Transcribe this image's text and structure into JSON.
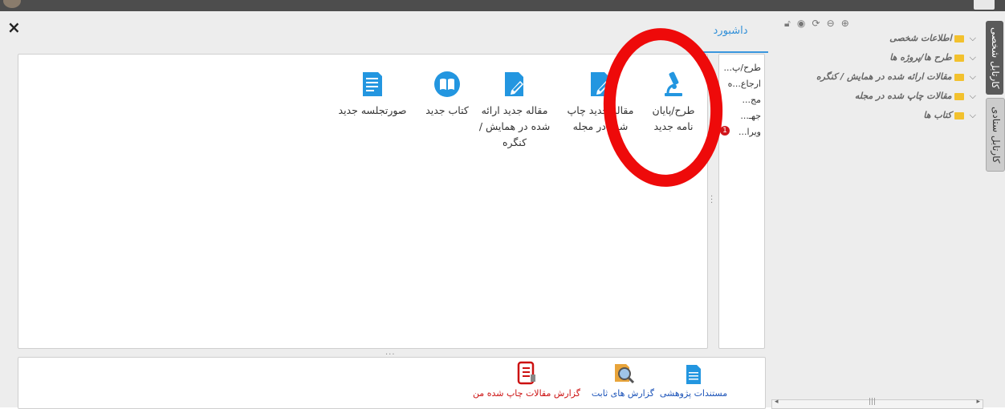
{
  "main": {
    "close_label": "×",
    "tab_label": "داشبورد",
    "sidebar_items": [
      "طرح/پ...",
      "ارجاع...ه",
      "مج...",
      "جهـ...",
      "ویرا..."
    ],
    "sidebar_badge": "1",
    "tiles": [
      {
        "label": "طرح/پایان نامه جدید",
        "icon": "microscope-icon"
      },
      {
        "label": "مقاله جدید چاپ شده در مجله",
        "icon": "document-edit-icon"
      },
      {
        "label": "مقاله جدید ارائه شده در همایش / کنگره",
        "icon": "document-edit-icon"
      },
      {
        "label": "کتاب جدید",
        "icon": "book-icon"
      },
      {
        "label": "صورتجلسه جدید",
        "icon": "document-list-icon"
      }
    ],
    "bottom_tiles": [
      {
        "label": "مستندات پژوهشی",
        "icon": "document-icon",
        "color": "#1a52b8"
      },
      {
        "label": "گزارش های ثابت",
        "icon": "report-search-icon",
        "color": "#1a52b8"
      },
      {
        "label": "گزارش مقالات چاپ شده من",
        "icon": "report-list-icon",
        "color": "#cc1111"
      }
    ]
  },
  "tree": {
    "toolbar_icons": [
      "unlock-icon",
      "record-icon",
      "refresh-icon",
      "minus-icon",
      "plus-icon"
    ],
    "items": [
      {
        "label": "اطلاعات شخصی"
      },
      {
        "label": "طرح ها/پروژه ها"
      },
      {
        "label": "مقالات ارائه شده در همایش / کنگره"
      },
      {
        "label": "مقالات چاپ شده در مجله"
      },
      {
        "label": "کتاب ها"
      }
    ]
  },
  "vertical_tabs": {
    "personal": "کارتابل شخصی",
    "staff": "کارتابل ستادی"
  },
  "colors": {
    "accent": "#2f8fd8",
    "icon_blue": "#2396e0",
    "annotation_red": "#ee0a0a"
  }
}
